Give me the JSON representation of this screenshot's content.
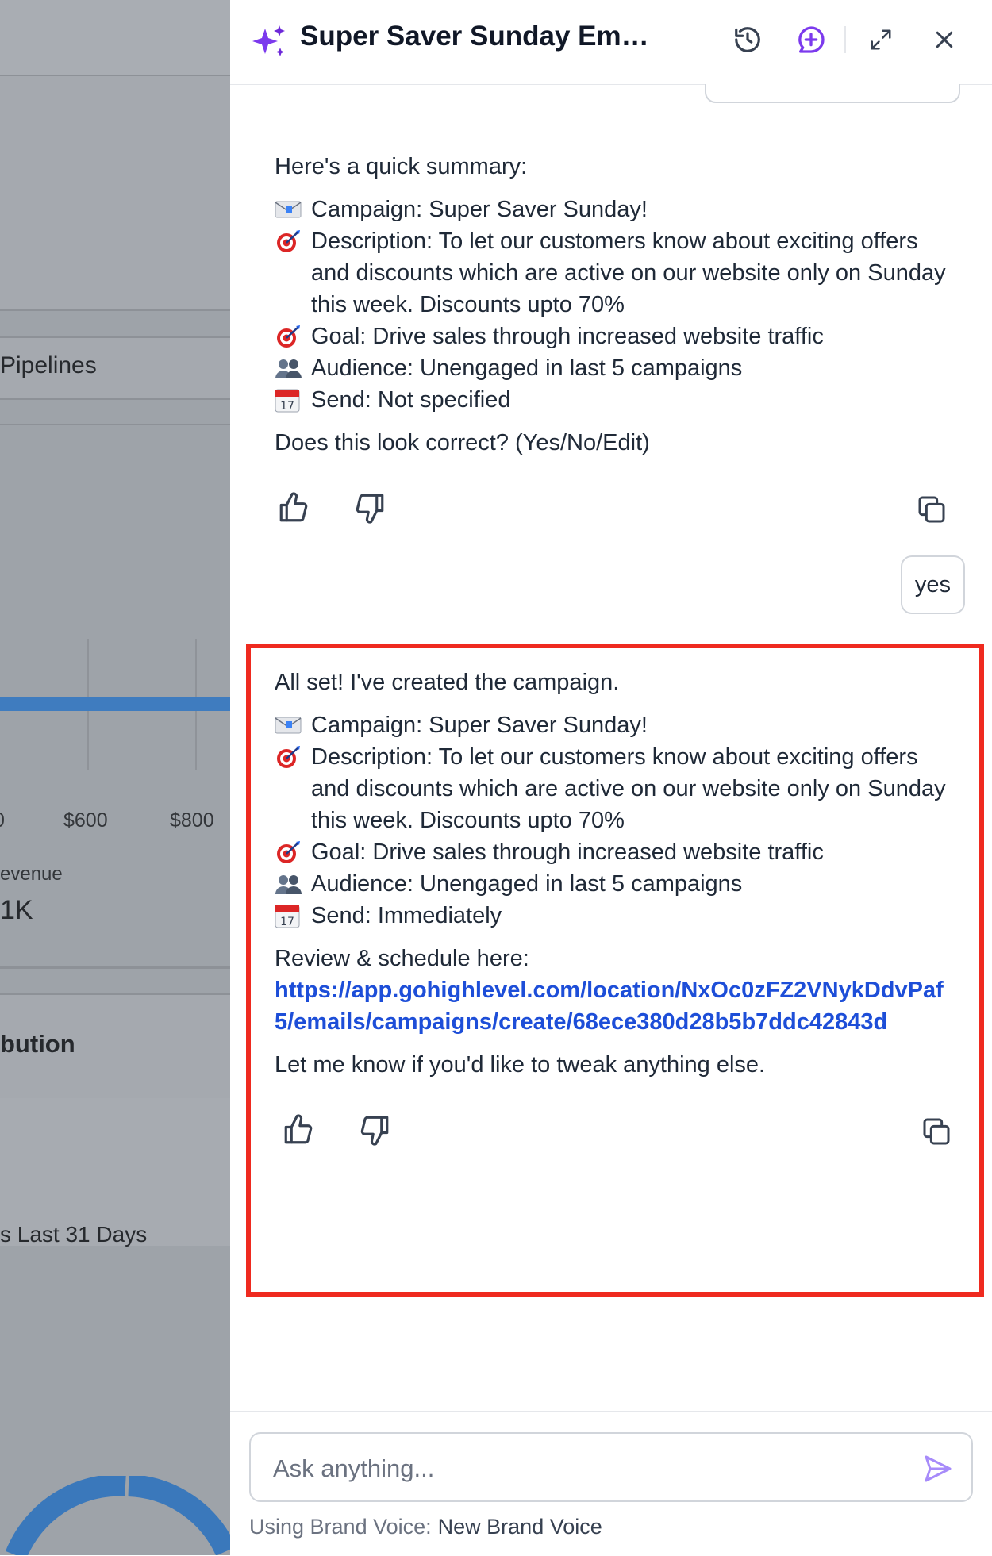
{
  "background": {
    "pipelines_label": "Pipelines",
    "axis_labels": [
      "0",
      "$600",
      "$800"
    ],
    "revenue_label": "evenue",
    "revenue_value": "1K",
    "section_label": "bution",
    "range_label": "s Last 31 Days"
  },
  "header": {
    "title": "Super Saver Sunday Ema..."
  },
  "summary_message": {
    "intro": "Here's a quick summary:",
    "lines": [
      {
        "icon": "envelope-icon",
        "text": "Campaign: Super Saver Sunday!"
      },
      {
        "icon": "target-icon",
        "text": "Description: To let our customers know about exciting offers and discounts which are active on our website only on Sunday this week. Discounts upto 70%"
      },
      {
        "icon": "target-icon",
        "text": "Goal: Drive sales through increased website traffic"
      },
      {
        "icon": "audience-icon",
        "text": "Audience: Unengaged in last 5 campaigns"
      },
      {
        "icon": "calendar-icon",
        "text": "Send: Not specified"
      }
    ],
    "question": "Does this look correct? (Yes/No/Edit)"
  },
  "user_message": "yes",
  "confirm_message": {
    "intro": "All set! I've created the campaign.",
    "lines": [
      {
        "icon": "envelope-icon",
        "text": "Campaign: Super Saver Sunday!"
      },
      {
        "icon": "target-icon",
        "text": "Description: To let our customers know about exciting offers and discounts which are active on our website only on Sunday this week. Discounts upto 70%"
      },
      {
        "icon": "target-icon",
        "text": "Goal: Drive sales through increased website traffic"
      },
      {
        "icon": "audience-icon",
        "text": "Audience: Unengaged in last 5 campaigns"
      },
      {
        "icon": "calendar-icon",
        "text": "Send: Immediately"
      }
    ],
    "review_label": "Review & schedule here:",
    "review_link": "https://app.gohighlevel.com/location/NxOc0zFZ2VNykDdvPaf5/emails/campaigns/create/68ece380d28b5b7ddc42843d",
    "closing": "Let me know if you'd like to tweak anything else."
  },
  "composer": {
    "placeholder": "Ask anything...",
    "brand_prefix": "Using Brand Voice:",
    "brand_name": "New Brand Voice"
  },
  "colors": {
    "accent": "#7c3aed",
    "link": "#1d4ed8",
    "highlight": "#ef2a1f"
  }
}
